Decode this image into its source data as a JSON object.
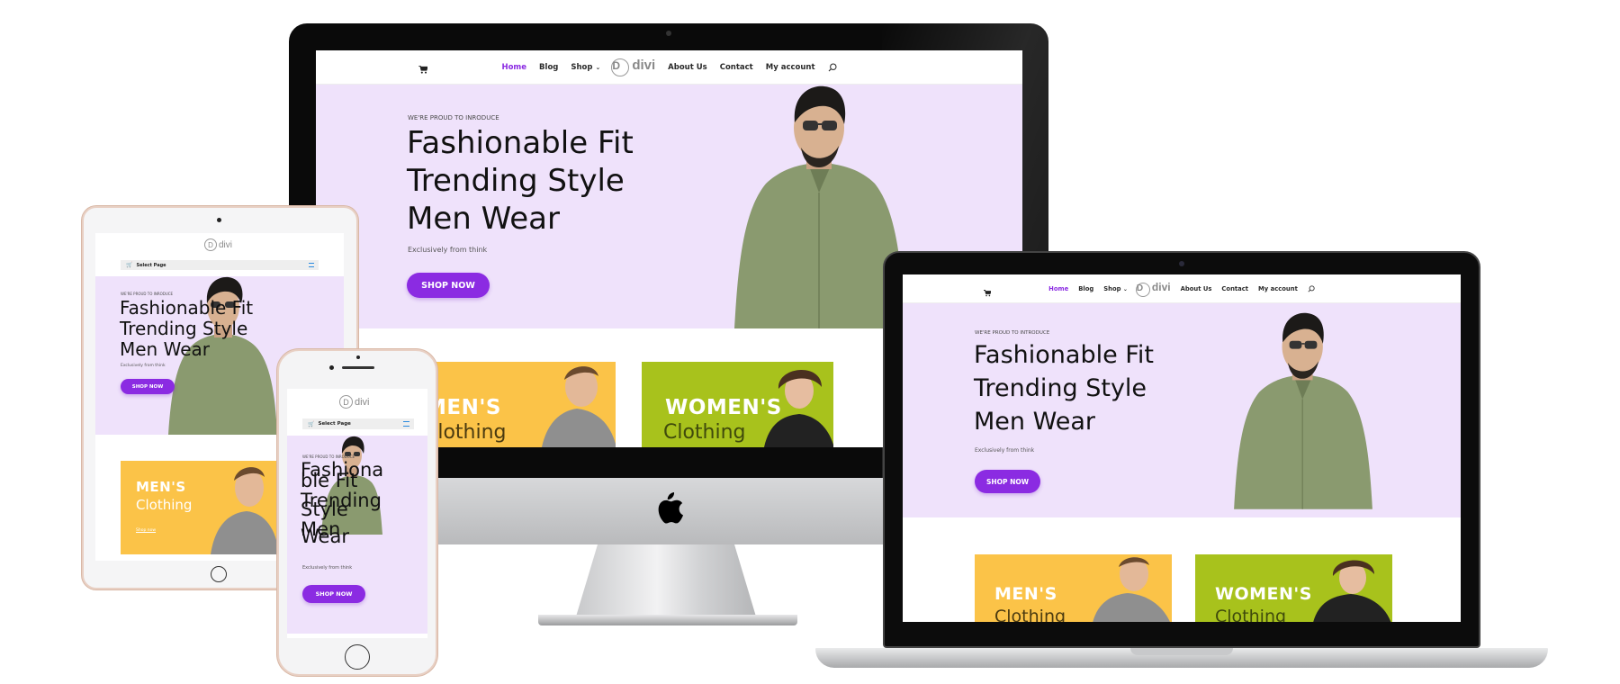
{
  "nav": {
    "cart_icon": "cart-icon",
    "items": [
      {
        "label": "Home"
      },
      {
        "label": "Blog"
      },
      {
        "label": "Shop"
      },
      {
        "label": "About Us"
      },
      {
        "label": "Contact"
      },
      {
        "label": "My account"
      }
    ],
    "logo_letter": "D",
    "logo_text": "divi",
    "search_icon": "search-icon",
    "select_page": "Select Page"
  },
  "hero": {
    "eyebrow": "WE'RE PROUD TO INRODUCE",
    "eyebrow_laptop": "WE'RE PROUD TO INTRODUCE",
    "line1": "Fashionable Fit",
    "line2": "Trending Style",
    "line3": "Men Wear",
    "phone_line1": "Fashiona",
    "phone_line2": "ble Fit",
    "phone_line3": "Trending",
    "phone_line4": "Style",
    "phone_line5": "Men",
    "phone_line6": "Wear",
    "subtitle": "Exclusively from think",
    "button": "SHOP NOW"
  },
  "cards": {
    "mens_title": "MEN'S",
    "womens_title": "WOMEN'S",
    "subtitle": "Clothing",
    "link": "Shop now"
  },
  "colors": {
    "accent": "#8b2be2",
    "hero_bg": "#efe2fb",
    "mens_bg": "#fbc348",
    "womens_bg": "#a8c21c"
  }
}
